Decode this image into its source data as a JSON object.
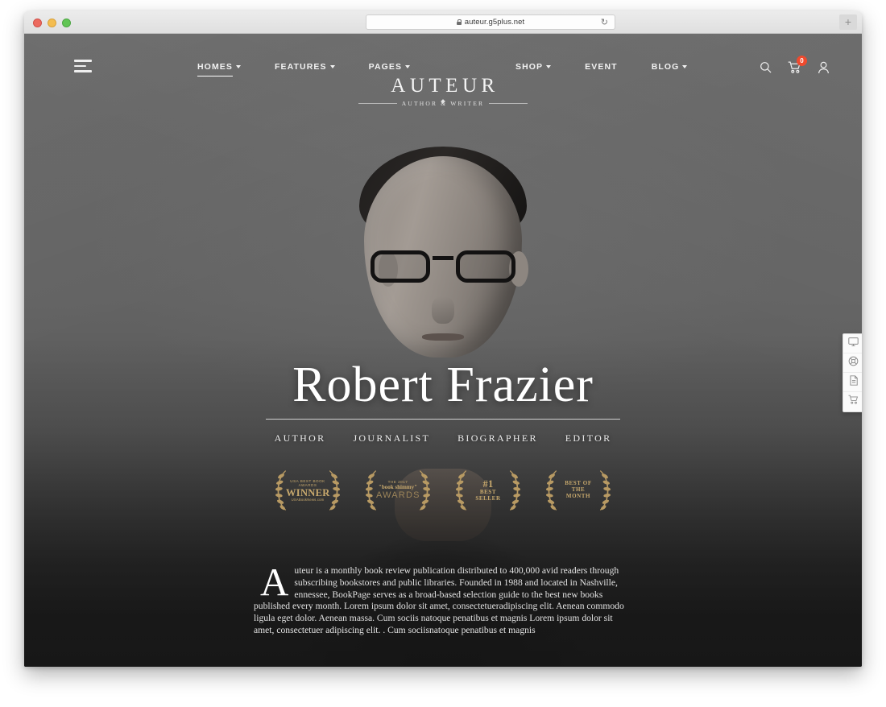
{
  "browser": {
    "url": "auteur.g5plus.net",
    "lock_icon": "lock-icon",
    "reload_icon": "reload-icon",
    "new_tab_label": "+",
    "traffic_lights": [
      "close",
      "minimize",
      "maximize"
    ]
  },
  "header": {
    "menu_icon": "hamburger-icon",
    "nav_left": [
      {
        "label": "HOMES",
        "has_dropdown": true,
        "active": true
      },
      {
        "label": "FEATURES",
        "has_dropdown": true,
        "active": false
      },
      {
        "label": "PAGES",
        "has_dropdown": true,
        "active": false
      }
    ],
    "nav_right": [
      {
        "label": "SHOP",
        "has_dropdown": true,
        "active": false
      },
      {
        "label": "EVENT",
        "has_dropdown": false,
        "active": false
      },
      {
        "label": "BLOG",
        "has_dropdown": true,
        "active": false
      }
    ],
    "brand": {
      "name": "AUTEUR",
      "tagline": "AUTHOR & WRITER"
    },
    "tools": {
      "search_icon": "search-icon",
      "cart_icon": "cart-icon",
      "cart_count": "0",
      "account_icon": "user-icon"
    }
  },
  "hero": {
    "name": "Robert Frazier",
    "roles": [
      "AUTHOR",
      "JOURNALIST",
      "BIOGRAPHER",
      "EDITOR"
    ],
    "awards": [
      {
        "name": "usa-best-book-awards-winner",
        "line1": "USA BEST BOOK",
        "line2": "AWARDS",
        "line3": "WINNER",
        "line4": "USABookNews.com"
      },
      {
        "name": "book-shimmy-awards",
        "line1": "THE 2017",
        "line2": "\"book shimmy\"",
        "line3": "AWARDS",
        "line4": ""
      },
      {
        "name": "number-one-best-seller",
        "line1": "",
        "line2": "#1",
        "line3": "BEST",
        "line4": "SELLER"
      },
      {
        "name": "best-of-the-month",
        "line1": "",
        "line2": "BEST OF",
        "line3": "THE",
        "line4": "MONTH"
      }
    ]
  },
  "intro": {
    "dropcap": "A",
    "body": "uteur is a monthly book review publication distributed to 400,000 avid readers through subscribing bookstores and public libraries. Founded in 1988 and located in Nashville, ennessee, BookPage serves as a broad-based selection guide to the best new books published every month. Lorem ipsum dolor sit amet, consectetueradipiscing elit. Aenean commodo ligula eget dolor. Aenean massa. Cum sociis natoque penatibus et magnis Lorem ipsum dolor sit amet, consectetuer adipiscing elit. . Cum sociisnatoque penatibus et magnis"
  },
  "side_toolbar": {
    "buttons": [
      {
        "name": "monitor-icon",
        "label": "Demo"
      },
      {
        "name": "globe-icon",
        "label": "Support"
      },
      {
        "name": "document-icon",
        "label": "Documentation"
      },
      {
        "name": "cart-icon",
        "label": "Purchase"
      }
    ]
  },
  "colors": {
    "accent_gold": "#c8a96d",
    "badge_red": "#ef4a2e",
    "page_bg": "#616161",
    "text_light": "#ededed"
  }
}
